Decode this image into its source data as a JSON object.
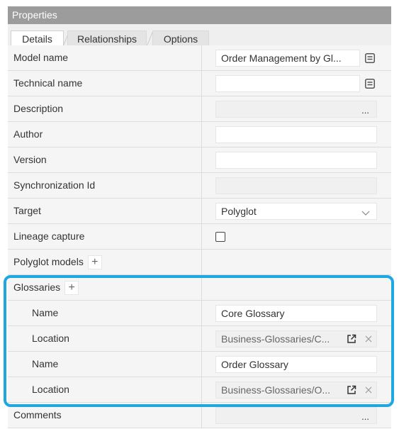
{
  "panel": {
    "title": "Properties"
  },
  "tabs": [
    {
      "label": "Details",
      "active": true
    },
    {
      "label": "Relationships",
      "active": false
    },
    {
      "label": "Options",
      "active": false
    }
  ],
  "rows": {
    "model_name": {
      "label": "Model name",
      "value": "Order Management by Gl..."
    },
    "technical_name": {
      "label": "Technical name",
      "value": ""
    },
    "description": {
      "label": "Description",
      "value": "",
      "button": "..."
    },
    "author": {
      "label": "Author",
      "value": ""
    },
    "version": {
      "label": "Version",
      "value": ""
    },
    "sync_id": {
      "label": "Synchronization Id",
      "value": ""
    },
    "target": {
      "label": "Target",
      "value": "Polyglot"
    },
    "lineage": {
      "label": "Lineage capture",
      "checked": false
    },
    "polyglot_models": {
      "label": "Polyglot models",
      "add": "+"
    },
    "glossaries": {
      "label": "Glossaries",
      "add": "+"
    },
    "glossary_items": [
      {
        "name_label": "Name",
        "name": "Core Glossary",
        "location_label": "Location",
        "location": "Business-Glossaries/C..."
      },
      {
        "name_label": "Name",
        "name": "Order Glossary",
        "location_label": "Location",
        "location": "Business-Glossaries/O..."
      }
    ],
    "comments": {
      "label": "Comments",
      "value": "",
      "button": "..."
    }
  },
  "colors": {
    "header": "#9c9c9c",
    "highlight": "#1fa8e0",
    "row_bg": "#f5f5f5"
  },
  "icons": {
    "list_editor": "list-editor-icon",
    "open_link": "open-external-icon",
    "remove": "close-icon",
    "chevron": "chevron-down-icon"
  }
}
